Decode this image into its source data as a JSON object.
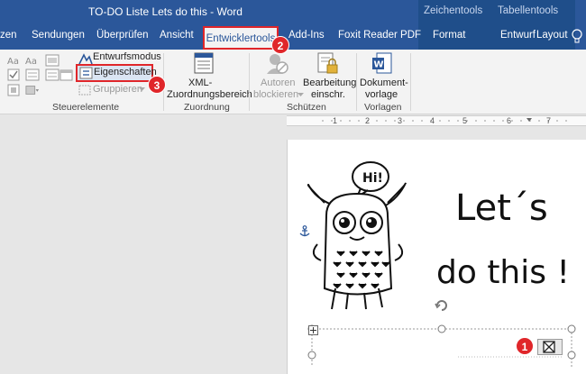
{
  "window": {
    "title": "TO-DO Liste Lets do this  -  Word",
    "context_groups": [
      "Zeichentools",
      "Tabellentools"
    ]
  },
  "tabs": {
    "sendungen": "Sendungen",
    "ueberpruefen": "Überprüfen",
    "ansicht": "Ansicht",
    "entwicklertools": "Entwicklertools",
    "addins": "Add-Ins",
    "foxit": "Foxit Reader PDF",
    "format": "Format",
    "entwurf": "Entwurf",
    "layout": "Layout",
    "partial_left": "zen"
  },
  "ribbon": {
    "steuerelemente": {
      "entwurfsmodus": "Entwurfsmodus",
      "eigenschaften": "Eigenschaften",
      "gruppieren": "Gruppieren",
      "label": "Steuerelemente"
    },
    "zuordnung": {
      "xml_line1": "XML-",
      "xml_line2": "Zuordnungsbereich",
      "label": "Zuordnung"
    },
    "schuetzen": {
      "autoren_line1": "Autoren",
      "autoren_line2": "blockieren",
      "bearbeitung_line1": "Bearbeitung",
      "bearbeitung_line2": "einschr.",
      "label": "Schützen"
    },
    "vorlagen": {
      "dok_line1": "Dokument-",
      "dok_line2": "vorlage",
      "label": "Vorlagen"
    }
  },
  "annotations": {
    "step1": "1",
    "step2": "2",
    "step3": "3"
  },
  "ruler": {
    "numbers": [
      "1",
      "2",
      "3",
      "4",
      "5",
      "6",
      "7"
    ]
  },
  "document": {
    "speech_bubble": "Hi!",
    "heading_line1": "Let´s",
    "heading_line2": "do this !"
  },
  "colors": {
    "word_blue": "#2b579a",
    "context_blue": "#1f4e8a",
    "marker_red": "#e0262a"
  },
  "icons": [
    "text-control-icon",
    "checkbox-control-icon",
    "properties-icon",
    "design-mode-icon",
    "xml-mapping-icon",
    "block-authors-icon",
    "restrict-editing-icon",
    "document-template-icon",
    "anchor-icon",
    "rotate-handle-icon",
    "move-handle-icon",
    "checkbox-symbol-icon",
    "lightbulb-icon"
  ]
}
